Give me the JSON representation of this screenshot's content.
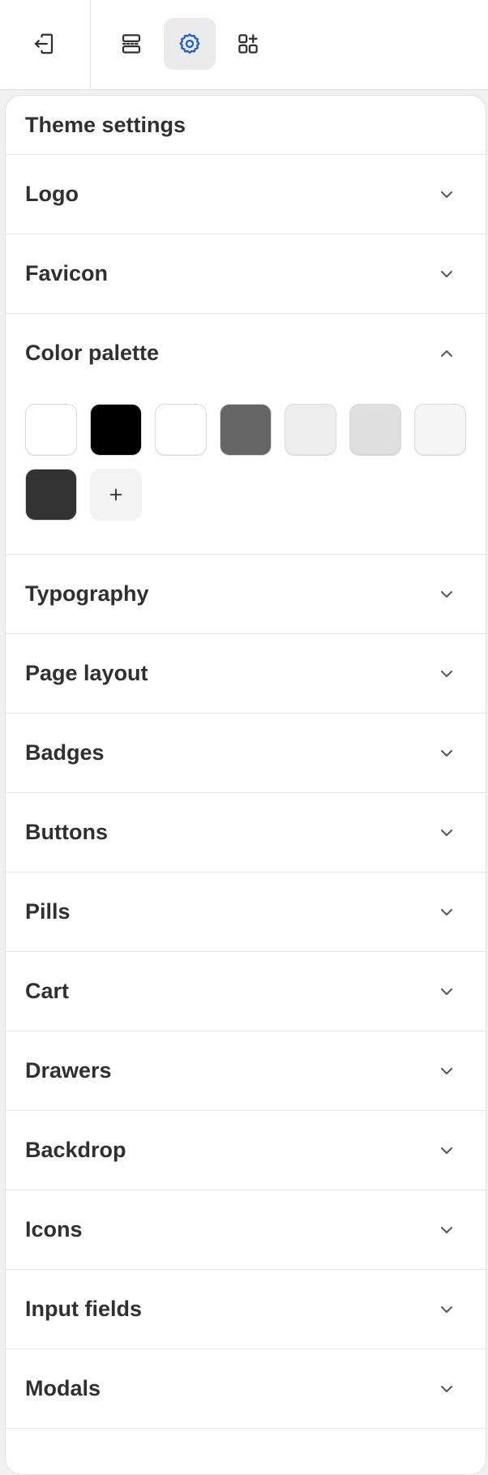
{
  "topbar": {
    "exit_icon": "exit-icon",
    "sections_icon": "sections-icon",
    "settings_icon": "gear-icon",
    "apps_icon": "apps-add-icon",
    "active_color": "#1f5fd1"
  },
  "panel": {
    "title": "Theme settings",
    "sections": [
      {
        "label": "Logo",
        "expanded": false
      },
      {
        "label": "Favicon",
        "expanded": false
      },
      {
        "label": "Color palette",
        "expanded": true
      },
      {
        "label": "Typography",
        "expanded": false
      },
      {
        "label": "Page layout",
        "expanded": false
      },
      {
        "label": "Badges",
        "expanded": false
      },
      {
        "label": "Buttons",
        "expanded": false
      },
      {
        "label": "Pills",
        "expanded": false
      },
      {
        "label": "Cart",
        "expanded": false
      },
      {
        "label": "Drawers",
        "expanded": false
      },
      {
        "label": "Backdrop",
        "expanded": false
      },
      {
        "label": "Icons",
        "expanded": false
      },
      {
        "label": "Input fields",
        "expanded": false
      },
      {
        "label": "Modals",
        "expanded": false
      }
    ],
    "palette": {
      "swatches": [
        "#ffffff",
        "#000000",
        "#ffffff",
        "#666666",
        "#eeeeee",
        "#dfdfdf",
        "#f5f5f5",
        "#333333"
      ],
      "add_icon": "plus-icon"
    }
  }
}
